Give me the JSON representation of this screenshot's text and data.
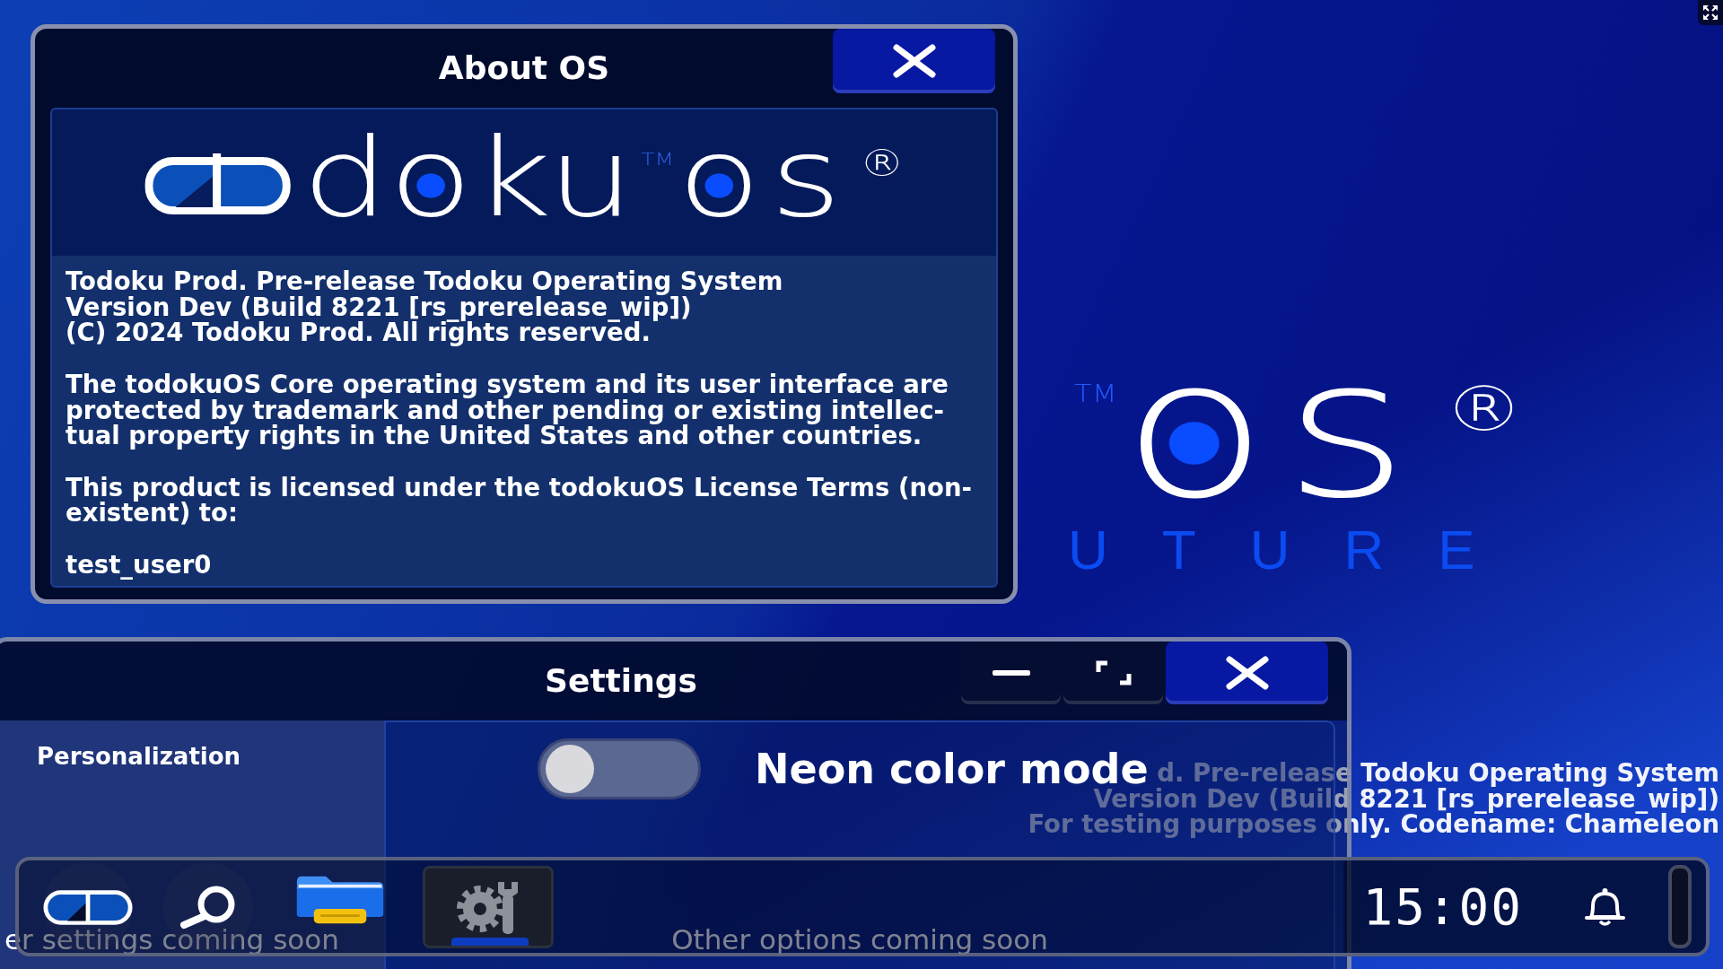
{
  "desktop_logo": {
    "trademark": "TM",
    "suffix": "os",
    "registered": "®",
    "tagline": "UTURE"
  },
  "desktop_watermark": [
    "d. Pre-release Todoku Operating System",
    "Version Dev (Build 8221 [rs_prerelease_wip])",
    "For testing purposes only. Codename: Chameleon"
  ],
  "about_window": {
    "title": "About OS",
    "logo": {
      "wordmark": "doku",
      "trademark": "TM",
      "suffix": "os",
      "registered": "®"
    },
    "paragraphs": [
      "Todoku Prod. Pre-release Todoku Operating System\nVersion Dev (Build 8221 [rs_prerelease_wip])\n(C) 2024 Todoku Prod. All rights reserved.",
      "The todokuOS Core operating system and its user interface are\nprotected by trademark and other pending or existing intellec-\ntual property rights in the United States and other countries.",
      "This product is licensed under the todokuOS License Terms (non-\nexistent) to:",
      "test_user0"
    ]
  },
  "settings_window": {
    "title": "Settings",
    "sidebar": {
      "items": [
        {
          "label": "Personalization"
        }
      ],
      "footer": "er settings coming soon"
    },
    "options": [
      {
        "label": "Neon color mode",
        "on": false
      }
    ],
    "footer": "Other options coming soon"
  },
  "taskbar": {
    "apps": [
      {
        "kind": "launcher",
        "selected": false
      },
      {
        "kind": "search",
        "selected": false
      },
      {
        "kind": "files",
        "selected": false
      },
      {
        "kind": "settings",
        "selected": true
      }
    ],
    "clock": "15:00"
  }
}
